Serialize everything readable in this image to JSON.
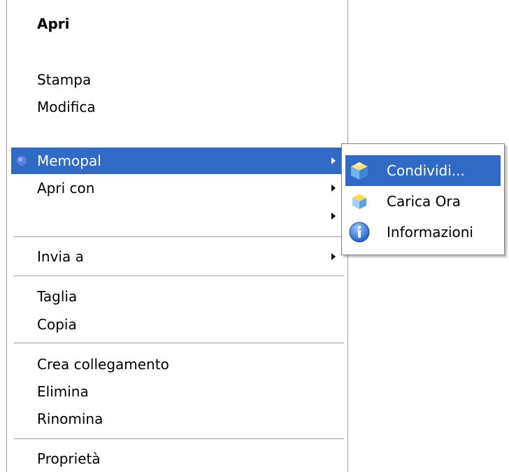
{
  "menu": {
    "items": [
      {
        "label": "Apri"
      },
      {
        "label": "Stampa"
      },
      {
        "label": "Modifica"
      },
      {
        "label": "Memopal"
      },
      {
        "label": "Apri con"
      },
      {
        "label": ""
      },
      {
        "label": "Invia a"
      },
      {
        "label": "Taglia"
      },
      {
        "label": "Copia"
      },
      {
        "label": "Crea collegamento"
      },
      {
        "label": "Elimina"
      },
      {
        "label": "Rinomina"
      },
      {
        "label": "Proprietà"
      }
    ]
  },
  "submenu": {
    "items": [
      {
        "label": "Condividi...",
        "icon": "share-cube-icon"
      },
      {
        "label": "Carica Ora",
        "icon": "upload-cube-icon"
      },
      {
        "label": "Informazioni",
        "icon": "info-icon"
      }
    ]
  },
  "colors": {
    "highlight": "#316ac5",
    "highlight_text": "#ffffff",
    "separator": "#a0a0a0"
  }
}
